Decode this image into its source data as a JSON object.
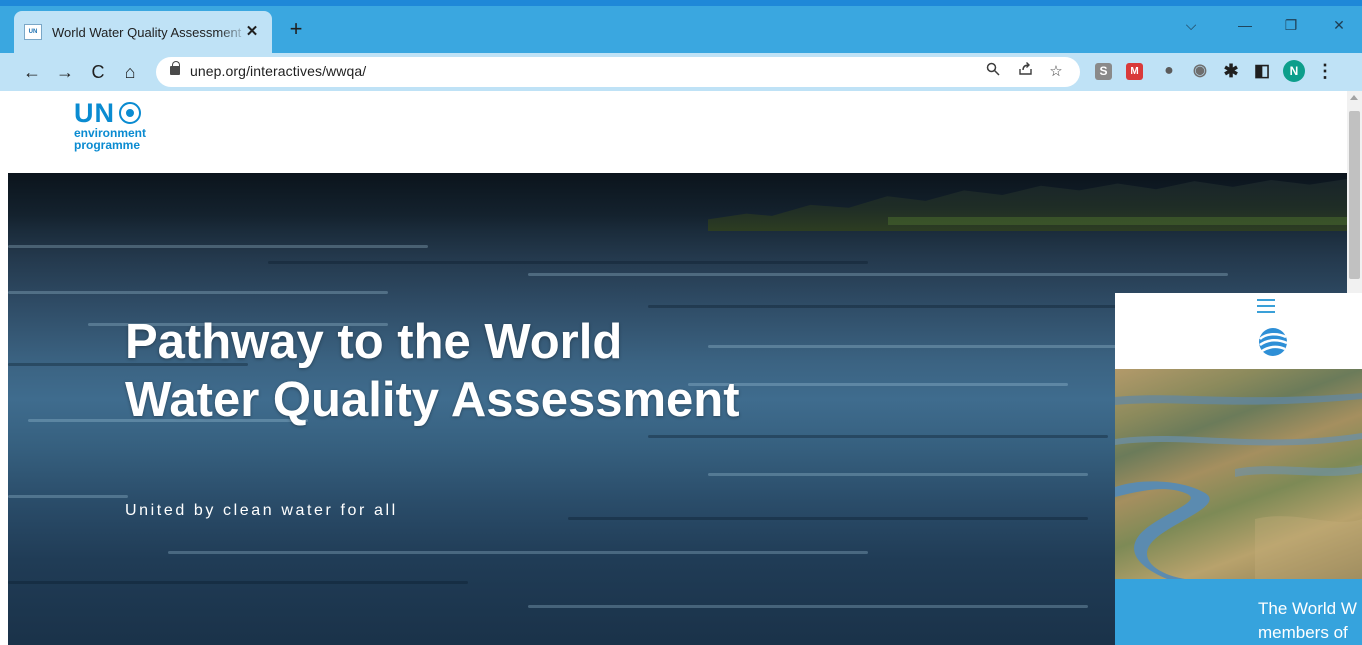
{
  "browser": {
    "tab": {
      "favicon_text": "UN",
      "title": "World Water Quality Assessment",
      "close": "✕"
    },
    "new_tab": "+",
    "window_controls": {
      "dropdown": "⌵",
      "minimize": "—",
      "restore": "❐",
      "close": "✕"
    },
    "nav": {
      "back": "←",
      "forward": "→",
      "reload": "C",
      "home": "⌂"
    },
    "address": {
      "url": "unep.org/interactives/wwqa/"
    },
    "omni_icons": {
      "zoom": "🔍",
      "share": "⇪",
      "bookmark": "☆"
    },
    "extensions": [
      {
        "name": "s-extension-icon",
        "label": "S",
        "color": "#8a8a8a"
      },
      {
        "name": "red-extension-icon",
        "label": "M",
        "color": "#d93a3a"
      },
      {
        "name": "gear-extension-icon",
        "label": "●",
        "color": "#5b5b5b"
      },
      {
        "name": "circle-extension-icon",
        "label": "◉",
        "color": "#6e6e6e"
      },
      {
        "name": "puzzle-icon",
        "label": "✱",
        "color": "#1f1f1f"
      },
      {
        "name": "sidepanel-icon",
        "label": "◧",
        "color": "#1f1f1f"
      },
      {
        "name": "profile-avatar",
        "label": "N",
        "color": "#0d9e8b"
      },
      {
        "name": "menu-icon",
        "label": "⋮",
        "color": "#1f1f1f"
      }
    ]
  },
  "logo": {
    "un": "UN",
    "line1": "environment",
    "line2": "programme",
    "color": "#0a8bd1"
  },
  "hero": {
    "title": "Pathway to the World Water Quality Assessment",
    "subtitle": "United by clean water for all"
  },
  "panel": {
    "text_line1": "The World W",
    "text_line2": "members of",
    "accent": "#36a3dd"
  }
}
